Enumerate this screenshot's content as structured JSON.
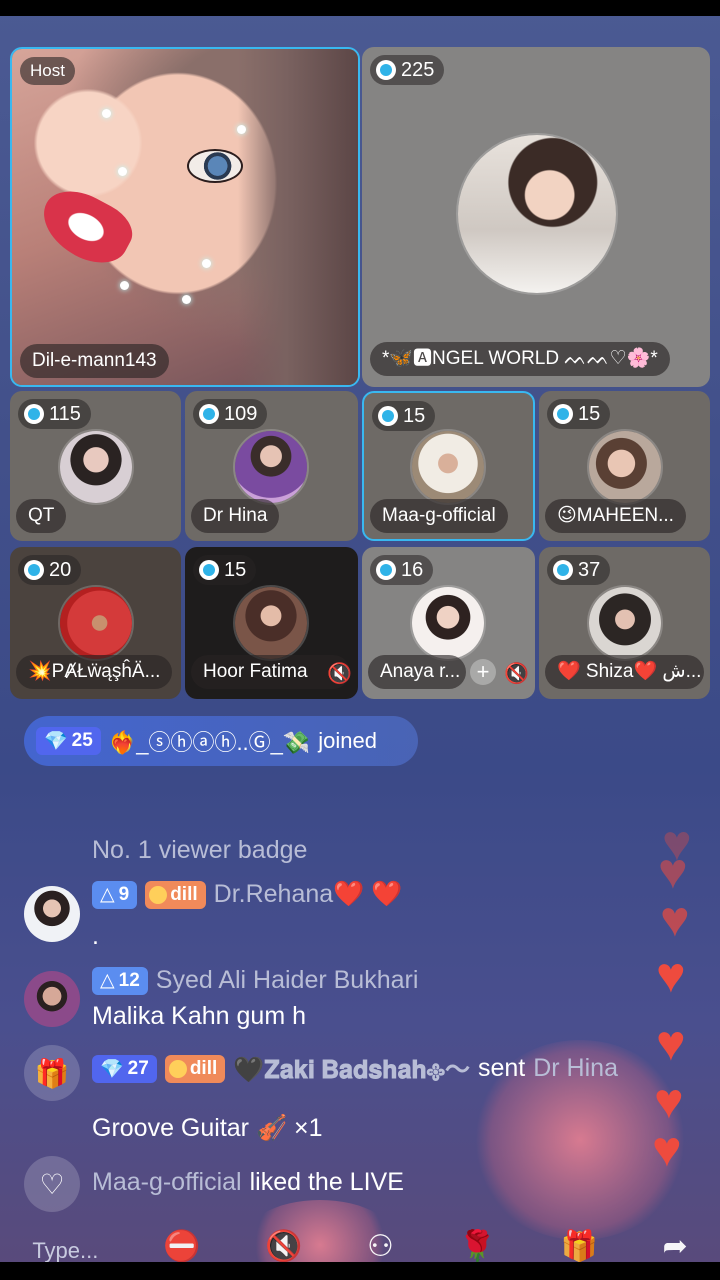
{
  "host": {
    "tag": "Host",
    "name": "Dil-e-mann143"
  },
  "guest_main": {
    "count": "225",
    "name": "*🦋🅰NGEL WORLD ᨓᨓ♡🌸*"
  },
  "seats": [
    {
      "count": "115",
      "name": "QT"
    },
    {
      "count": "109",
      "name": "Dr Hina"
    },
    {
      "count": "15",
      "name": "Maa-g-official"
    },
    {
      "count": "15",
      "name": "😉MAHEEN..."
    },
    {
      "count": "20",
      "name": "💥PȺŁẅąşĥÄ..."
    },
    {
      "count": "15",
      "name": "Hoor Fatima"
    },
    {
      "count": "16",
      "name": "Anaya r..."
    },
    {
      "count": "37",
      "name": "❤️ Shiza❤️ ش..."
    }
  ],
  "join": {
    "level": "25",
    "user": "❤️‍🔥_ⓢⓗⓐⓗ..Ⓖ_💸",
    "action": "joined"
  },
  "chat": {
    "badge_line": "No. 1 viewer badge",
    "msg1": {
      "level": "9",
      "badge": "dill",
      "user": "Dr.Rehana❤️ ❤️",
      "text": "."
    },
    "msg2": {
      "level": "12",
      "user": "Syed Ali Haider Bukhari",
      "text": "Malika Kahn gum h"
    },
    "gift": {
      "level": "27",
      "badge": "dill",
      "user": "🖤𝐙𝐚𝐤𝐢 𝐁𝐚𝐝𝐬𝐡𝐚𝐡𐫱〜",
      "sent": "sent",
      "target": "Dr Hina",
      "gift_line": "Groove Guitar 🎻 ×1"
    },
    "like": {
      "user": "Maa-g-official",
      "text": "liked the LIVE"
    }
  },
  "bottom": {
    "input_placeholder": "Type..."
  }
}
